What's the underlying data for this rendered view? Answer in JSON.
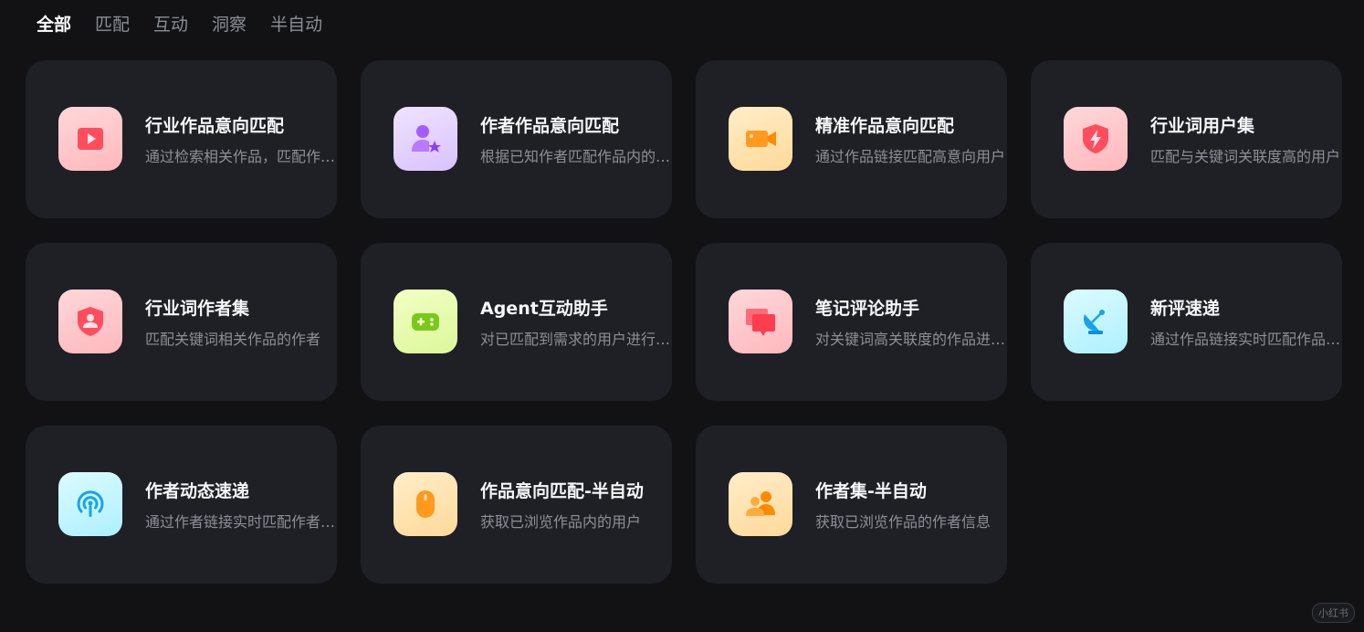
{
  "tabs": [
    {
      "label": "全部",
      "active": true
    },
    {
      "label": "匹配",
      "active": false
    },
    {
      "label": "互动",
      "active": false
    },
    {
      "label": "洞察",
      "active": false
    },
    {
      "label": "半自动",
      "active": false
    }
  ],
  "cards": [
    {
      "title": "行业作品意向匹配",
      "desc": "通过检索相关作品，匹配作品内的用户",
      "icon": "video-play-icon"
    },
    {
      "title": "作者作品意向匹配",
      "desc": "根据已知作者匹配作品内的用户",
      "icon": "user-star-icon"
    },
    {
      "title": "精准作品意向匹配",
      "desc": "通过作品链接匹配高意向用户",
      "icon": "video-camera-icon"
    },
    {
      "title": "行业词用户集",
      "desc": "匹配与关键词关联度高的用户",
      "icon": "shield-bolt-icon"
    },
    {
      "title": "行业词作者集",
      "desc": "匹配关键词相关作品的作者",
      "icon": "shield-user-icon"
    },
    {
      "title": "Agent互动助手",
      "desc": "对已匹配到需求的用户进行互动",
      "icon": "gamepad-icon"
    },
    {
      "title": "笔记评论助手",
      "desc": "对关键词高关联度的作品进行评论",
      "icon": "comments-icon"
    },
    {
      "title": "新评速递",
      "desc": "通过作品链接实时匹配作品新评论",
      "icon": "satellite-dish-icon"
    },
    {
      "title": "作者动态速递",
      "desc": "通过作者链接实时匹配作者动态",
      "icon": "broadcast-icon"
    },
    {
      "title": "作品意向匹配-半自动",
      "desc": "获取已浏览作品内的用户",
      "icon": "mouse-icon"
    },
    {
      "title": "作者集-半自动",
      "desc": "获取已浏览作品的作者信息",
      "icon": "users-icon"
    }
  ],
  "watermark": "小红书",
  "colors": {
    "background": "#121214",
    "card": "#1f2025",
    "tab_active": "#ffffff",
    "tab_inactive": "#8a8d96"
  }
}
